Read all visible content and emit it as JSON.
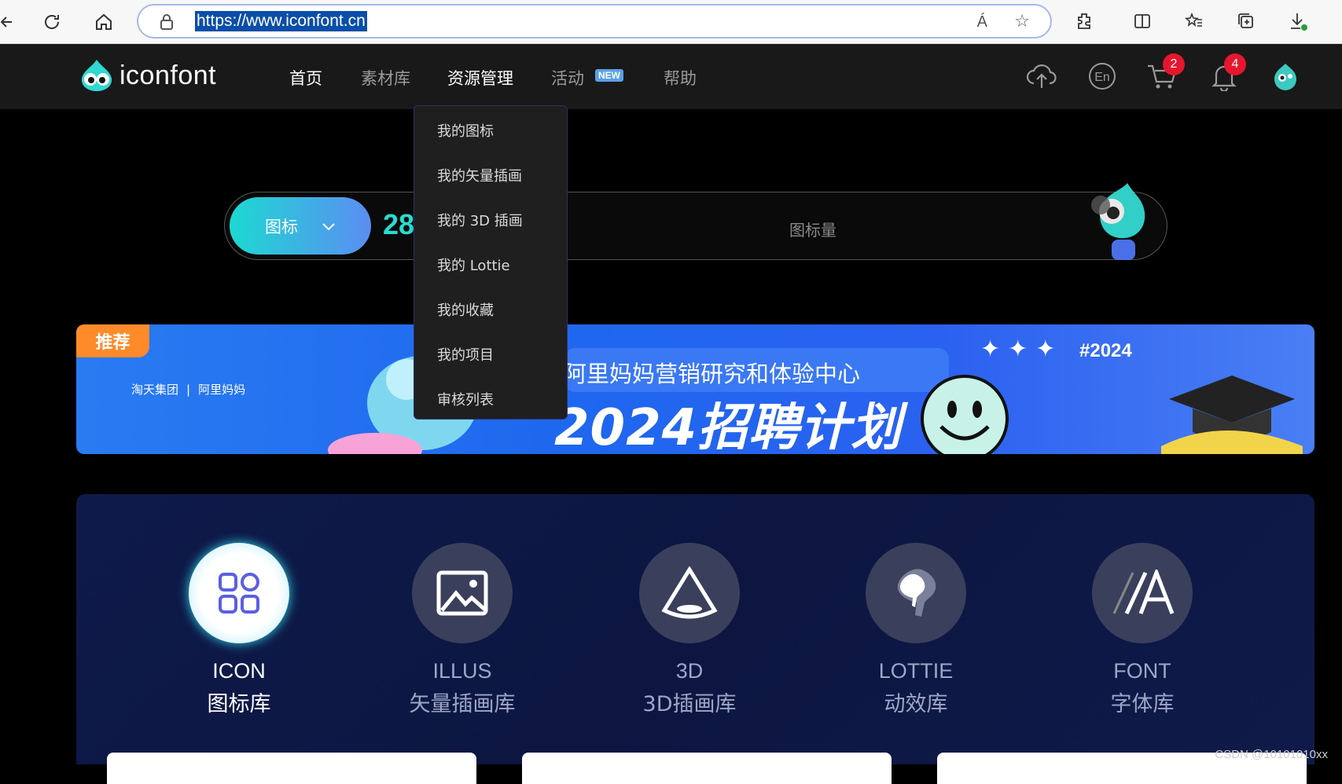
{
  "browser": {
    "url": "https://www.iconfont.cn",
    "read_aloud_icon": "Á"
  },
  "site": {
    "logo_text": "iconfont",
    "nav": [
      {
        "label": "首页"
      },
      {
        "label": "素材库"
      },
      {
        "label": "资源管理"
      },
      {
        "label": "活动"
      },
      {
        "label": "帮助"
      }
    ],
    "new_badge": "NEW",
    "cart_count": "2",
    "notification_count": "4"
  },
  "search": {
    "type_label": "图标",
    "count_partial": "28",
    "suffix_partial": "图标量"
  },
  "dropdown": {
    "items": [
      {
        "label": "我的图标"
      },
      {
        "label": "我的矢量插画"
      },
      {
        "label": "我的 3D 插画"
      },
      {
        "label": "我的 Lottie"
      },
      {
        "label": "我的收藏"
      },
      {
        "label": "我的项目"
      },
      {
        "label": "审核列表"
      }
    ]
  },
  "banner": {
    "tag": "推荐",
    "partner_1": "淘天集团",
    "partner_2": "阿里妈妈",
    "title_line1": "阿里妈妈营销研究和体验中心",
    "title_line2": "2024招聘计划",
    "year_tag": "#2024"
  },
  "categories": [
    {
      "en": "ICON",
      "cn": "图标库",
      "icon": "grid-icon"
    },
    {
      "en": "ILLUS",
      "cn": "矢量插画库",
      "icon": "image-icon"
    },
    {
      "en": "3D",
      "cn": "3D插画库",
      "icon": "cone-icon"
    },
    {
      "en": "LOTTIE",
      "cn": "动效库",
      "icon": "lottie-icon"
    },
    {
      "en": "FONT",
      "cn": "字体库",
      "icon": "font-icon"
    }
  ],
  "watermark": "CSDN @10101010xx",
  "colors": {
    "accent_cyan": "#27dccf",
    "badge_red": "#e5172e",
    "banner_blue": "#1e67ee",
    "tag_orange": "#ff8a2a"
  }
}
